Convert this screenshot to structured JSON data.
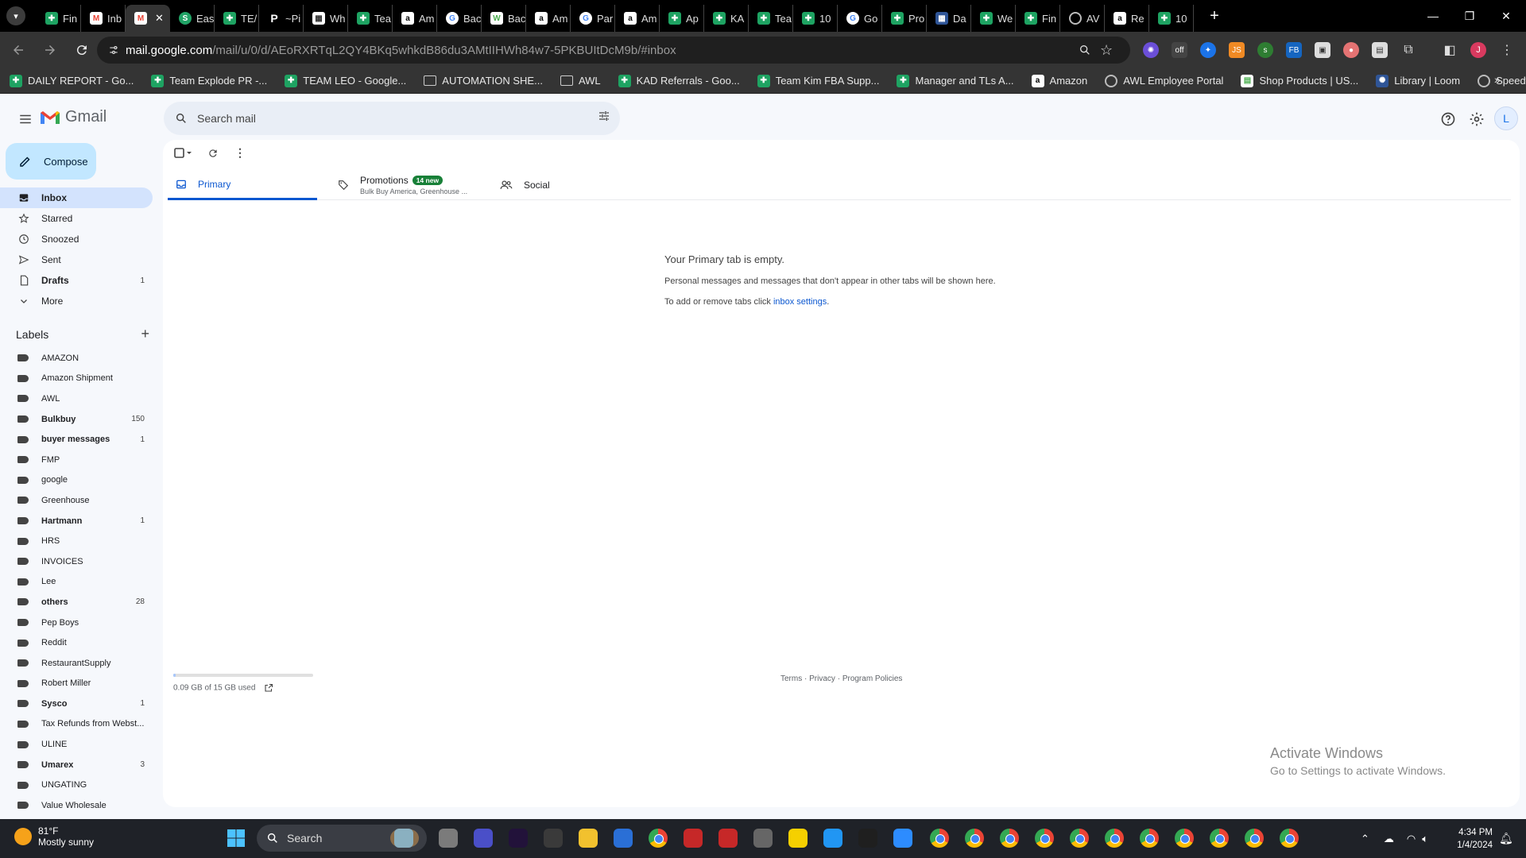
{
  "browser": {
    "tabs": [
      {
        "label": "Fin",
        "favicon": "sheets-icon"
      },
      {
        "label": "Inb",
        "favicon": "gmail-icon"
      },
      {
        "label": "",
        "favicon": "gmail-icon",
        "active": true
      },
      {
        "label": "Eas",
        "favicon": "s-icon"
      },
      {
        "label": "TE/",
        "favicon": "sheets-icon"
      },
      {
        "label": "~Pi",
        "favicon": "p-icon"
      },
      {
        "label": "Wh",
        "favicon": "doc-icon"
      },
      {
        "label": "Tea",
        "favicon": "sheets-icon"
      },
      {
        "label": "Am",
        "favicon": "amazon-icon"
      },
      {
        "label": "Bac",
        "favicon": "google-icon"
      },
      {
        "label": "Bac",
        "favicon": "w-icon"
      },
      {
        "label": "Am",
        "favicon": "amazon-icon"
      },
      {
        "label": "Par",
        "favicon": "google-icon"
      },
      {
        "label": "Am",
        "favicon": "amazon-icon"
      },
      {
        "label": "Ap",
        "favicon": "sheets-icon"
      },
      {
        "label": "KA",
        "favicon": "sheets-icon"
      },
      {
        "label": "Tea",
        "favicon": "sheets-icon"
      },
      {
        "label": "10",
        "favicon": "sheets-icon"
      },
      {
        "label": "Go",
        "favicon": "google-icon"
      },
      {
        "label": "Pro",
        "favicon": "sheets-icon"
      },
      {
        "label": "Da",
        "favicon": "blue-icon"
      },
      {
        "label": "We",
        "favicon": "sheets-icon"
      },
      {
        "label": "Fin",
        "favicon": "sheets-icon"
      },
      {
        "label": "AV",
        "favicon": "globe-icon"
      },
      {
        "label": "Re",
        "favicon": "amazon-icon"
      },
      {
        "label": "10",
        "favicon": "sheets-icon"
      }
    ],
    "url_host": "mail.google.com",
    "url_path": "/mail/u/0/d/AEoRXRTqL2QY4BKq5whkdB86du3AMtIIHWh84w7-5PKBUItDcM9b/#inbox",
    "bookmarks": [
      {
        "label": "DAILY REPORT - Go...",
        "icon": "sheets-icon"
      },
      {
        "label": "Team Explode PR -...",
        "icon": "sheets-icon"
      },
      {
        "label": "TEAM LEO - Google...",
        "icon": "sheets-icon"
      },
      {
        "label": "AUTOMATION SHE...",
        "icon": "folder-icon"
      },
      {
        "label": "AWL",
        "icon": "folder-icon"
      },
      {
        "label": "KAD Referrals - Goo...",
        "icon": "sheets-icon"
      },
      {
        "label": "Team Kim FBA Supp...",
        "icon": "sheets-icon"
      },
      {
        "label": "Manager and TLs A...",
        "icon": "sheets-icon"
      },
      {
        "label": "Amazon",
        "icon": "amazon-icon"
      },
      {
        "label": "AWL Employee Portal",
        "icon": "globe-icon"
      },
      {
        "label": "Shop Products | US...",
        "icon": "shop-icon"
      },
      {
        "label": "Library | Loom",
        "icon": "loom-icon"
      },
      {
        "label": "Speedtest by Ookla...",
        "icon": "speedtest-icon"
      }
    ],
    "profile_initial": "J"
  },
  "gmail": {
    "app_name": "Gmail",
    "search_placeholder": "Search mail",
    "account_initial": "L",
    "compose_label": "Compose",
    "nav": [
      {
        "label": "Inbox",
        "icon": "inbox-icon",
        "count": "",
        "active": true
      },
      {
        "label": "Starred",
        "icon": "star-icon",
        "count": ""
      },
      {
        "label": "Snoozed",
        "icon": "clock-icon",
        "count": ""
      },
      {
        "label": "Sent",
        "icon": "send-icon",
        "count": ""
      },
      {
        "label": "Drafts",
        "icon": "draft-icon",
        "count": "1",
        "bold": true
      },
      {
        "label": "More",
        "icon": "chevron-down-icon",
        "count": ""
      }
    ],
    "labels_title": "Labels",
    "labels": [
      {
        "label": "AMAZON",
        "count": ""
      },
      {
        "label": "Amazon Shipment",
        "count": ""
      },
      {
        "label": "AWL",
        "count": ""
      },
      {
        "label": "Bulkbuy",
        "count": "150",
        "bold": true
      },
      {
        "label": "buyer messages",
        "count": "1",
        "bold": true
      },
      {
        "label": "FMP",
        "count": ""
      },
      {
        "label": "google",
        "count": ""
      },
      {
        "label": "Greenhouse",
        "count": ""
      },
      {
        "label": "Hartmann",
        "count": "1",
        "bold": true
      },
      {
        "label": "HRS",
        "count": ""
      },
      {
        "label": "INVOICES",
        "count": ""
      },
      {
        "label": "Lee",
        "count": ""
      },
      {
        "label": "others",
        "count": "28",
        "bold": true
      },
      {
        "label": "Pep Boys",
        "count": ""
      },
      {
        "label": "Reddit",
        "count": ""
      },
      {
        "label": "RestaurantSupply",
        "count": ""
      },
      {
        "label": "Robert Miller",
        "count": ""
      },
      {
        "label": "Sysco",
        "count": "1",
        "bold": true
      },
      {
        "label": "Tax Refunds from Webst...",
        "count": ""
      },
      {
        "label": "ULINE",
        "count": ""
      },
      {
        "label": "Umarex",
        "count": "3",
        "bold": true
      },
      {
        "label": "UNGATING",
        "count": ""
      },
      {
        "label": "Value Wholesale",
        "count": ""
      }
    ],
    "categories": {
      "primary": "Primary",
      "promotions": "Promotions",
      "promotions_badge": "14 new",
      "promotions_sub": "Bulk Buy America, Greenhouse ...",
      "social": "Social"
    },
    "empty": {
      "title": "Your Primary tab is empty.",
      "line1": "Personal messages and messages that don't appear in other tabs will be shown here.",
      "line2_prefix": "To add or remove tabs click ",
      "line2_link": "inbox settings",
      "line2_suffix": "."
    },
    "storage": {
      "text": "0.09 GB of 15 GB used",
      "fraction": 0.006
    },
    "footer": {
      "terms": "Terms",
      "privacy": "Privacy",
      "program": "Program Policies",
      "sep": " · "
    }
  },
  "windows": {
    "activate_title": "Activate Windows",
    "activate_sub": "Go to Settings to activate Windows.",
    "weather_temp": "81°F",
    "weather_desc": "Mostly sunny",
    "search_placeholder": "Search",
    "time": "4:34 PM",
    "date": "1/4/2024"
  },
  "colors": {
    "accent": "#0b57d0",
    "compose_bg": "#c2e7ff",
    "inbox_active": "#d3e3fd",
    "badge_green": "#188038"
  }
}
